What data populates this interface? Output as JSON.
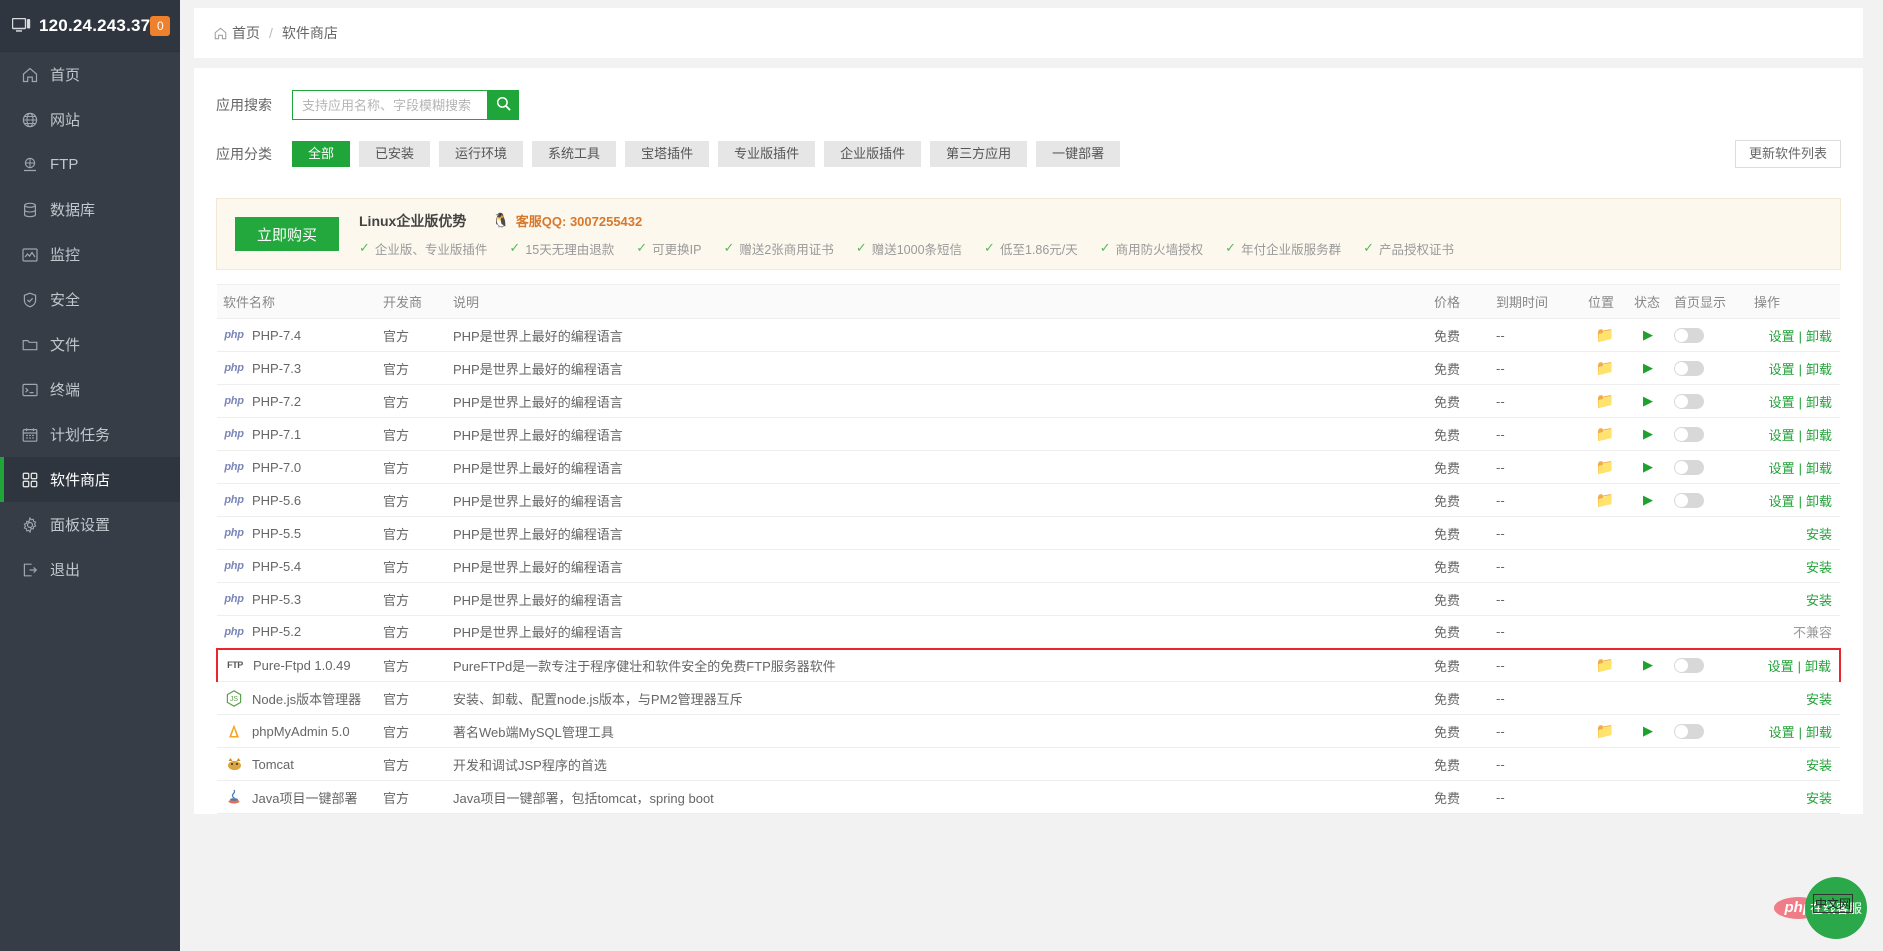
{
  "sidebar": {
    "ip": "120.24.243.37",
    "badge": "0",
    "items": [
      {
        "label": "首页",
        "icon": "home-icon"
      },
      {
        "label": "网站",
        "icon": "globe-icon"
      },
      {
        "label": "FTP",
        "icon": "ftp-icon"
      },
      {
        "label": "数据库",
        "icon": "database-icon"
      },
      {
        "label": "监控",
        "icon": "monitor-icon"
      },
      {
        "label": "安全",
        "icon": "shield-icon"
      },
      {
        "label": "文件",
        "icon": "folder-icon"
      },
      {
        "label": "终端",
        "icon": "terminal-icon"
      },
      {
        "label": "计划任务",
        "icon": "calendar-icon"
      },
      {
        "label": "软件商店",
        "icon": "grid-icon"
      },
      {
        "label": "面板设置",
        "icon": "gear-icon"
      },
      {
        "label": "退出",
        "icon": "logout-icon"
      }
    ],
    "active_index": 9
  },
  "breadcrumb": {
    "home": "首页",
    "separator": "/",
    "current": "软件商店"
  },
  "filters": {
    "search_label": "应用搜索",
    "search_placeholder": "支持应用名称、字段模糊搜索",
    "search_value": "",
    "search_icon": "search-icon",
    "category_label": "应用分类",
    "categories": [
      {
        "label": "全部",
        "active": true
      },
      {
        "label": "已安装",
        "active": false
      },
      {
        "label": "运行环境",
        "active": false
      },
      {
        "label": "系统工具",
        "active": false
      },
      {
        "label": "宝塔插件",
        "active": false
      },
      {
        "label": "专业版插件",
        "active": false
      },
      {
        "label": "企业版插件",
        "active": false
      },
      {
        "label": "第三方应用",
        "active": false
      },
      {
        "label": "一键部署",
        "active": false
      }
    ],
    "update_button": "更新软件列表"
  },
  "promo": {
    "buy_button": "立即购买",
    "title": "Linux企业版优势",
    "qq_icon": "qq-penguin-icon",
    "qq_text": "客服QQ: 3007255432",
    "features": [
      "企业版、专业版插件",
      "15天无理由退款",
      "可更换IP",
      "赠送2张商用证书",
      "赠送1000条短信",
      "低至1.86元/天",
      "商用防火墙授权",
      "年付企业版服务群",
      "产品授权证书"
    ]
  },
  "table": {
    "headers": {
      "name": "软件名称",
      "dev": "开发商",
      "desc": "说明",
      "price": "价格",
      "expire": "到期时间",
      "position": "位置",
      "status": "状态",
      "homepage": "首页显示",
      "ops": "操作"
    },
    "op_labels": {
      "settings": "设置",
      "uninstall": "卸载",
      "separator": "|",
      "install": "安装",
      "incompatible": "不兼容"
    },
    "rows": [
      {
        "icon": "php-icon",
        "icon_text": "php",
        "name": "PHP-7.4",
        "dev": "官方",
        "desc": "PHP是世界上最好的编程语言",
        "price": "免费",
        "expire": "--",
        "installed": true,
        "ops": "manage",
        "highlight": false
      },
      {
        "icon": "php-icon",
        "icon_text": "php",
        "name": "PHP-7.3",
        "dev": "官方",
        "desc": "PHP是世界上最好的编程语言",
        "price": "免费",
        "expire": "--",
        "installed": true,
        "ops": "manage",
        "highlight": false
      },
      {
        "icon": "php-icon",
        "icon_text": "php",
        "name": "PHP-7.2",
        "dev": "官方",
        "desc": "PHP是世界上最好的编程语言",
        "price": "免费",
        "expire": "--",
        "installed": true,
        "ops": "manage",
        "highlight": false
      },
      {
        "icon": "php-icon",
        "icon_text": "php",
        "name": "PHP-7.1",
        "dev": "官方",
        "desc": "PHP是世界上最好的编程语言",
        "price": "免费",
        "expire": "--",
        "installed": true,
        "ops": "manage",
        "highlight": false
      },
      {
        "icon": "php-icon",
        "icon_text": "php",
        "name": "PHP-7.0",
        "dev": "官方",
        "desc": "PHP是世界上最好的编程语言",
        "price": "免费",
        "expire": "--",
        "installed": true,
        "ops": "manage",
        "highlight": false
      },
      {
        "icon": "php-icon",
        "icon_text": "php",
        "name": "PHP-5.6",
        "dev": "官方",
        "desc": "PHP是世界上最好的编程语言",
        "price": "免费",
        "expire": "--",
        "installed": true,
        "ops": "manage",
        "highlight": false
      },
      {
        "icon": "php-icon",
        "icon_text": "php",
        "name": "PHP-5.5",
        "dev": "官方",
        "desc": "PHP是世界上最好的编程语言",
        "price": "免费",
        "expire": "--",
        "installed": false,
        "ops": "install",
        "highlight": false
      },
      {
        "icon": "php-icon",
        "icon_text": "php",
        "name": "PHP-5.4",
        "dev": "官方",
        "desc": "PHP是世界上最好的编程语言",
        "price": "免费",
        "expire": "--",
        "installed": false,
        "ops": "install",
        "highlight": false
      },
      {
        "icon": "php-icon",
        "icon_text": "php",
        "name": "PHP-5.3",
        "dev": "官方",
        "desc": "PHP是世界上最好的编程语言",
        "price": "免费",
        "expire": "--",
        "installed": false,
        "ops": "install",
        "highlight": false
      },
      {
        "icon": "php-icon",
        "icon_text": "php",
        "name": "PHP-5.2",
        "dev": "官方",
        "desc": "PHP是世界上最好的编程语言",
        "price": "免费",
        "expire": "--",
        "installed": false,
        "ops": "incompatible",
        "highlight": false
      },
      {
        "icon": "ftp-icon",
        "icon_text": "FTP",
        "name": "Pure-Ftpd 1.0.49",
        "dev": "官方",
        "desc": "PureFTPd是一款专注于程序健壮和软件安全的免费FTP服务器软件",
        "price": "免费",
        "expire": "--",
        "installed": true,
        "ops": "manage",
        "highlight": true
      },
      {
        "icon": "nodejs-icon",
        "icon_text": "JS",
        "name": "Node.js版本管理器",
        "dev": "官方",
        "desc": "安装、卸载、配置node.js版本，与PM2管理器互斥",
        "price": "免费",
        "expire": "--",
        "installed": false,
        "ops": "install",
        "highlight": false
      },
      {
        "icon": "phpmyadmin-icon",
        "icon_text": "pma",
        "name": "phpMyAdmin 5.0",
        "dev": "官方",
        "desc": "著名Web端MySQL管理工具",
        "price": "免费",
        "expire": "--",
        "installed": true,
        "ops": "manage",
        "highlight": false
      },
      {
        "icon": "tomcat-icon",
        "icon_text": "tc",
        "name": "Tomcat",
        "dev": "官方",
        "desc": "开发和调试JSP程序的首选",
        "price": "免费",
        "expire": "--",
        "installed": false,
        "ops": "install",
        "highlight": false
      },
      {
        "icon": "java-icon",
        "icon_text": "java",
        "name": "Java项目一键部署",
        "dev": "官方",
        "desc": "Java项目一键部署，包括tomcat，spring boot",
        "price": "免费",
        "expire": "--",
        "installed": false,
        "ops": "install",
        "highlight": false
      }
    ]
  },
  "floating": {
    "service_label": "在线客服",
    "watermark_php": "php",
    "watermark_cn": "中文网"
  },
  "colors": {
    "accent_green": "#20a53a",
    "sidebar_bg": "#363d47",
    "badge_orange": "#f0812c",
    "highlight_red": "#e8272c"
  }
}
